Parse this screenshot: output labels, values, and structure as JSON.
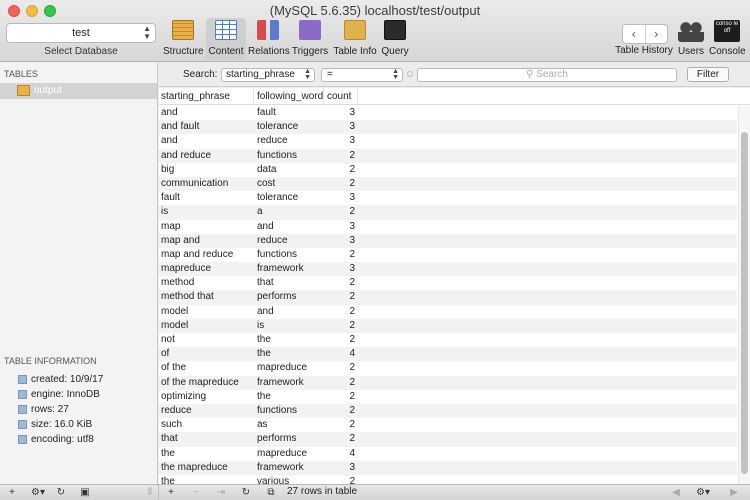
{
  "window": {
    "title": "(MySQL 5.6.35) localhost/test/output"
  },
  "database": {
    "value": "test",
    "caption": "Select Database"
  },
  "toolbar": {
    "structure": "Structure",
    "content": "Content",
    "relations": "Relations",
    "triggers": "Triggers",
    "table_info": "Table Info",
    "query": "Query",
    "table_history": "Table History",
    "users": "Users",
    "console": "Console",
    "console_icon_text": "conso le off"
  },
  "sidebar": {
    "tables_header": "TABLES",
    "selected_table": "output",
    "info_header": "TABLE INFORMATION",
    "info": [
      "created: 10/9/17",
      "engine: InnoDB",
      "rows: 27",
      "size: 16.0 KiB",
      "encoding: utf8"
    ]
  },
  "search": {
    "label": "Search:",
    "field": "starting_phrase",
    "operator": "=",
    "placeholder": "Search",
    "filter_button": "Filter"
  },
  "table": {
    "columns": [
      "starting_phrase",
      "following_word",
      "count"
    ],
    "rows": [
      [
        "and",
        "fault",
        "3"
      ],
      [
        "and fault",
        "tolerance",
        "3"
      ],
      [
        "and",
        "reduce",
        "3"
      ],
      [
        "and reduce",
        "functions",
        "2"
      ],
      [
        "big",
        "data",
        "2"
      ],
      [
        "communication",
        "cost",
        "2"
      ],
      [
        "fault",
        "tolerance",
        "3"
      ],
      [
        "is",
        "a",
        "2"
      ],
      [
        "map",
        "and",
        "3"
      ],
      [
        "map and",
        "reduce",
        "3"
      ],
      [
        "map and reduce",
        "functions",
        "2"
      ],
      [
        "mapreduce",
        "framework",
        "3"
      ],
      [
        "method",
        "that",
        "2"
      ],
      [
        "method that",
        "performs",
        "2"
      ],
      [
        "model",
        "and",
        "2"
      ],
      [
        "model",
        "is",
        "2"
      ],
      [
        "not",
        "the",
        "2"
      ],
      [
        "of",
        "the",
        "4"
      ],
      [
        "of the",
        "mapreduce",
        "2"
      ],
      [
        "of the mapreduce",
        "framework",
        "2"
      ],
      [
        "optimizing",
        "the",
        "2"
      ],
      [
        "reduce",
        "functions",
        "2"
      ],
      [
        "such",
        "as",
        "2"
      ],
      [
        "that",
        "performs",
        "2"
      ],
      [
        "the",
        "mapreduce",
        "4"
      ],
      [
        "the mapreduce",
        "framework",
        "3"
      ],
      [
        "the",
        "various",
        "2"
      ]
    ]
  },
  "status": {
    "rows_text": "27 rows in table"
  }
}
